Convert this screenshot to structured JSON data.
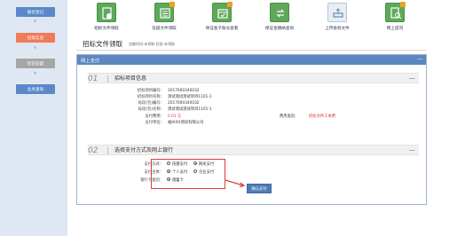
{
  "sidebar": {
    "items": [
      {
        "label": "报名登记",
        "color": "#5b88c8"
      },
      {
        "label": "招标信息",
        "color": "#ef7b5b"
      },
      {
        "label": "标前答疑",
        "color": "#a6a6a6"
      },
      {
        "label": "业务查询",
        "color": "#5b88c8"
      }
    ]
  },
  "toolbar": {
    "tools": [
      {
        "label": "招标文件领取",
        "icon": "document-money-icon"
      },
      {
        "label": "答疑文件领取",
        "icon": "document-list-icon"
      },
      {
        "label": "保证金子账号查看",
        "icon": "calendar-icon"
      },
      {
        "label": "保证金缴纳查询",
        "icon": "exchange-icon"
      },
      {
        "label": "上传投标文件",
        "icon": "upload-tray-icon"
      },
      {
        "label": "网上提问",
        "icon": "search-document-icon"
      }
    ]
  },
  "page": {
    "title": "招标文件领取",
    "subtitle": "金额时间:未领取 状态:未领取"
  },
  "dialog": {
    "title": "网上支付",
    "close": "—",
    "section1": {
      "num": "01",
      "title": "招标项目信息",
      "toggle": "—",
      "rows": [
        {
          "label": "招标项目编号：",
          "value": "2017000340032"
        },
        {
          "label": "招标项目名称：",
          "value": "测试测试测试项目1101-1"
        },
        {
          "label": "标段(包)编号：",
          "value": "2017000340032"
        },
        {
          "label": "标段(包)名称：",
          "value": "测试测试测试项目1101-1"
        },
        {
          "label": "支付费用：",
          "value": "0.01 元"
        },
        {
          "label": "支付单位：",
          "value": "福州XX测试有限公司"
        }
      ],
      "fee_type_label": "费用类别:",
      "fee_type_value": "招标文件工本费"
    },
    "section2": {
      "num": "02",
      "title": "选择支付方式及网上银行",
      "toggle": "—",
      "rows": [
        {
          "label": "支付方式：",
          "options": [
            "快捷支付",
            "网关支付"
          ],
          "selected": 1
        },
        {
          "label": "支付主体：",
          "options": [
            "个人支付",
            "企业支付"
          ],
          "selected": 0
        },
        {
          "label": "银行卡类别：",
          "options": [
            "储蓄卡"
          ],
          "selected": 0
        }
      ],
      "confirm_label": "确认支付"
    }
  },
  "colors": {
    "header_blue": "#5c87c0",
    "highlight_red": "#e23a3a",
    "tool_green": "#5fa85b",
    "fee_red": "#e12e2e"
  }
}
